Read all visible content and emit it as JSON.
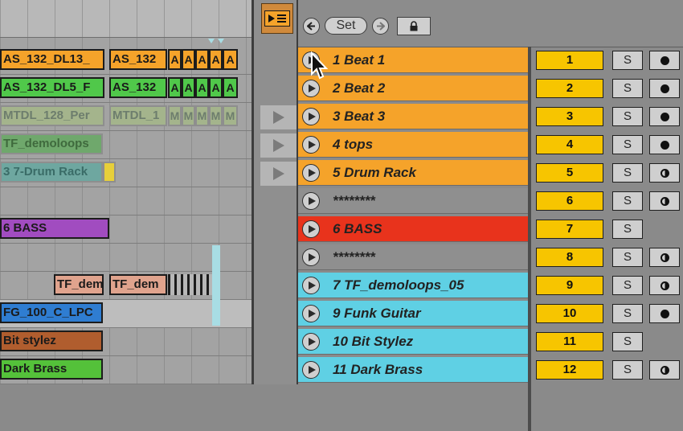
{
  "header": {
    "set_label": "Set",
    "follow_icon": "follow-icon",
    "back_icon": "◀",
    "forward_icon": "▶"
  },
  "arrangement": {
    "clips": [
      {
        "label": "AS_132_DL13_",
        "color": "#f5a32a"
      },
      {
        "label": "AS_132",
        "color": "#f5a32a"
      },
      {
        "label": "AS_132_DL5_F",
        "color": "#50c84a"
      },
      {
        "label": "AS_132",
        "color": "#50c84a"
      },
      {
        "label": "MTDL_128_Per",
        "color": "#a4b48c"
      },
      {
        "label": "MTDL_1",
        "color": "#a4b48c"
      },
      {
        "label": "TF_demoloops",
        "color": "#6fa86c"
      },
      {
        "label": "3 7-Drum Rack",
        "color": "#6ea7a0"
      },
      {
        "label": "6 BASS",
        "color": "#a14cc0"
      },
      {
        "label": "TF_dem",
        "color": "#e0a38d"
      },
      {
        "label": "TF_dem",
        "color": "#e0a38d"
      },
      {
        "label": "FG_100_C_LPC",
        "color": "#2f7dd1"
      },
      {
        "label": "Bit stylez",
        "color": "#b05d2e"
      },
      {
        "label": "Dark Brass",
        "color": "#54c13a"
      }
    ],
    "mini_letters": {
      "a": "A",
      "m": "M"
    }
  },
  "scenes": [
    {
      "name": "1 Beat 1",
      "number": "1",
      "color": "#f5a32a",
      "arm": "armed"
    },
    {
      "name": "2 Beat 2",
      "number": "2",
      "color": "#f5a32a",
      "arm": "armed"
    },
    {
      "name": "3 Beat 3",
      "number": "3",
      "color": "#f5a32a",
      "arm": "armed"
    },
    {
      "name": "4 tops",
      "number": "4",
      "color": "#f5a32a",
      "arm": "armed"
    },
    {
      "name": "5 Drum Rack",
      "number": "5",
      "color": "#f5a32a",
      "arm": "half"
    },
    {
      "name": "********",
      "number": "6",
      "color": "#8f8f8f",
      "arm": "half"
    },
    {
      "name": "6 BASS",
      "number": "7",
      "color": "#e8331c",
      "arm": "none"
    },
    {
      "name": "********",
      "number": "8",
      "color": "#8f8f8f",
      "arm": "half"
    },
    {
      "name": "7 TF_demoloops_05",
      "number": "9",
      "color": "#5fd0e4",
      "arm": "half"
    },
    {
      "name": "9 Funk Guitar",
      "number": "10",
      "color": "#5fd0e4",
      "arm": "armed"
    },
    {
      "name": "10 Bit Stylez",
      "number": "11",
      "color": "#5fd0e4",
      "arm": "none"
    },
    {
      "name": "11 Dark Brass",
      "number": "12",
      "color": "#5fd0e4",
      "arm": "half"
    }
  ],
  "solo_label": "S"
}
